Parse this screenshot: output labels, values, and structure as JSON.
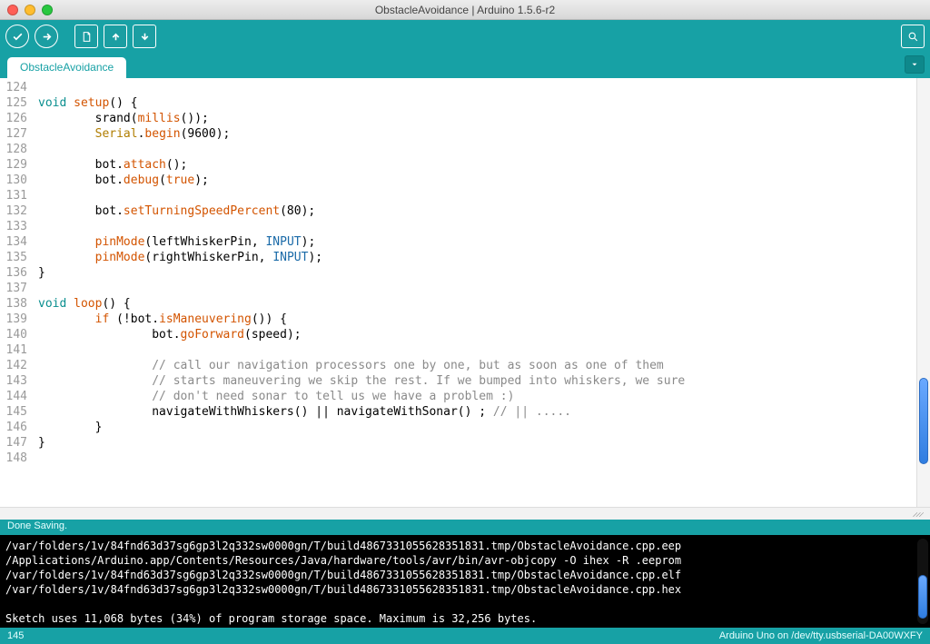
{
  "title": "ObstacleAvoidance | Arduino 1.5.6-r2",
  "tab": {
    "label": "ObstacleAvoidance"
  },
  "gutter": {
    "start": 124,
    "end": 148
  },
  "code": {
    "lines": [
      [],
      [
        [
          "type",
          "void"
        ],
        [
          "plain",
          " "
        ],
        [
          "fn",
          "setup"
        ],
        [
          "plain",
          "() {"
        ]
      ],
      [
        [
          "plain",
          "        srand("
        ],
        [
          "fn",
          "millis"
        ],
        [
          "plain",
          "());"
        ]
      ],
      [
        [
          "plain",
          "        "
        ],
        [
          "id",
          "Serial"
        ],
        [
          "plain",
          "."
        ],
        [
          "fn",
          "begin"
        ],
        [
          "plain",
          "(9600);"
        ]
      ],
      [],
      [
        [
          "plain",
          "        bot."
        ],
        [
          "fn",
          "attach"
        ],
        [
          "plain",
          "();"
        ]
      ],
      [
        [
          "plain",
          "        bot."
        ],
        [
          "fn",
          "debug"
        ],
        [
          "plain",
          "("
        ],
        [
          "kw",
          "true"
        ],
        [
          "plain",
          ");"
        ]
      ],
      [],
      [
        [
          "plain",
          "        bot."
        ],
        [
          "fn",
          "setTurningSpeedPercent"
        ],
        [
          "plain",
          "(80);"
        ]
      ],
      [],
      [
        [
          "plain",
          "        "
        ],
        [
          "fn",
          "pinMode"
        ],
        [
          "plain",
          "(leftWhiskerPin, "
        ],
        [
          "const",
          "INPUT"
        ],
        [
          "plain",
          ");"
        ]
      ],
      [
        [
          "plain",
          "        "
        ],
        [
          "fn",
          "pinMode"
        ],
        [
          "plain",
          "(rightWhiskerPin, "
        ],
        [
          "const",
          "INPUT"
        ],
        [
          "plain",
          ");"
        ]
      ],
      [
        [
          "plain",
          "}"
        ]
      ],
      [],
      [
        [
          "type",
          "void"
        ],
        [
          "plain",
          " "
        ],
        [
          "fn",
          "loop"
        ],
        [
          "plain",
          "() {"
        ]
      ],
      [
        [
          "plain",
          "        "
        ],
        [
          "kw",
          "if"
        ],
        [
          "plain",
          " (!bot."
        ],
        [
          "fn",
          "isManeuvering"
        ],
        [
          "plain",
          "()) {"
        ]
      ],
      [
        [
          "plain",
          "                bot."
        ],
        [
          "fn",
          "goForward"
        ],
        [
          "plain",
          "(speed);"
        ]
      ],
      [],
      [
        [
          "plain",
          "                "
        ],
        [
          "cmt",
          "// call our navigation processors one by one, but as soon as one of them"
        ]
      ],
      [
        [
          "plain",
          "                "
        ],
        [
          "cmt",
          "// starts maneuvering we skip the rest. If we bumped into whiskers, we sure"
        ]
      ],
      [
        [
          "plain",
          "                "
        ],
        [
          "cmt",
          "// don't need sonar to tell us we have a problem :)"
        ]
      ],
      [
        [
          "plain",
          "                navigateWithWhiskers() || navigateWithSonar() ; "
        ],
        [
          "cmt",
          "// || ....."
        ]
      ],
      [
        [
          "plain",
          "        }"
        ]
      ],
      [
        [
          "plain",
          "}"
        ]
      ],
      []
    ]
  },
  "status": "Done Saving.",
  "console": {
    "lines": [
      "/var/folders/1v/84fnd63d37sg6gp3l2q332sw0000gn/T/build4867331055628351831.tmp/ObstacleAvoidance.cpp.eep",
      "/Applications/Arduino.app/Contents/Resources/Java/hardware/tools/avr/bin/avr-objcopy -O ihex -R .eeprom",
      "/var/folders/1v/84fnd63d37sg6gp3l2q332sw0000gn/T/build4867331055628351831.tmp/ObstacleAvoidance.cpp.elf",
      "/var/folders/1v/84fnd63d37sg6gp3l2q332sw0000gn/T/build4867331055628351831.tmp/ObstacleAvoidance.cpp.hex",
      "",
      "Sketch uses 11,068 bytes (34%) of program storage space. Maximum is 32,256 bytes."
    ]
  },
  "footer": {
    "left": "145",
    "right": "Arduino Uno on /dev/tty.usbserial-DA00WXFY"
  }
}
